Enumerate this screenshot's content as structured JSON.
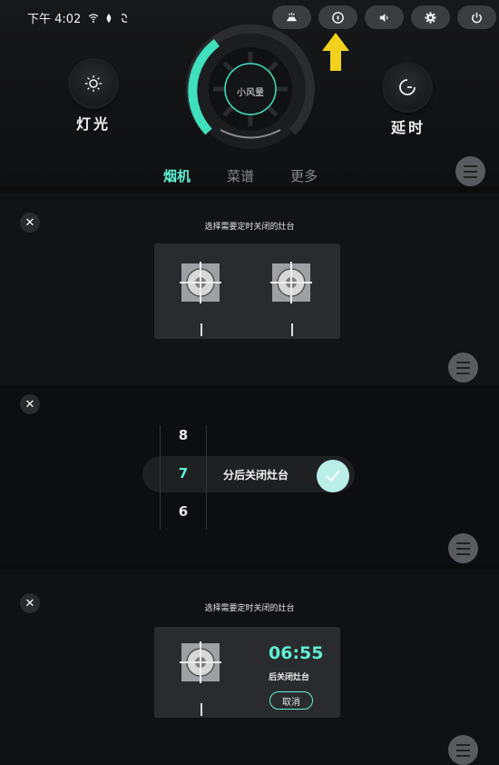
{
  "status_bar": {
    "time": "下午 4:02"
  },
  "top_buttons": [
    "fan-mode-icon",
    "timer-icon",
    "volume-icon",
    "gear-icon",
    "power-icon"
  ],
  "main": {
    "light_label": "灯光",
    "delay_label": "延时",
    "dial_center": "小风量",
    "tabs": [
      {
        "label": "烟机",
        "active": true
      },
      {
        "label": "菜谱",
        "active": false
      },
      {
        "label": "更多",
        "active": false
      }
    ]
  },
  "select_panel": {
    "title": "选择需要定时关闭的灶台",
    "close": "✕"
  },
  "minutes_panel": {
    "close": "✕",
    "wheel": [
      "8",
      "7",
      "6"
    ],
    "selected": "7",
    "suffix": "分后关闭灶台"
  },
  "timer_panel": {
    "title": "选择需要定时关闭的灶台",
    "close": "✕",
    "time": "06:55",
    "subtitle": "后关闭灶台",
    "cancel": "取消"
  },
  "colors": {
    "accent": "#5ff0d2",
    "highlight_arrow": "#f2d21e"
  }
}
